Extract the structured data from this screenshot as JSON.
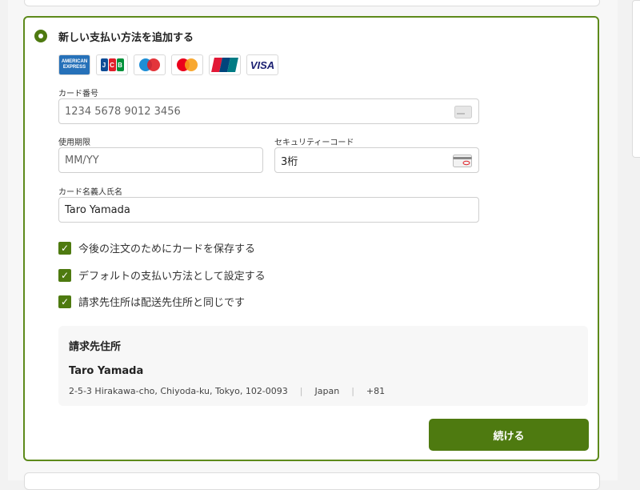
{
  "payment": {
    "title": "新しい支払い方法を追加する",
    "brands": [
      {
        "name": "American Express",
        "text_line1": "AMERICAN",
        "text_line2": "EXPRESS",
        "color": "#2671b9"
      },
      {
        "name": "JCB",
        "letters": [
          "J",
          "C",
          "B"
        ],
        "colors": [
          "#0e4c96",
          "#e11e2a",
          "#00913a"
        ]
      },
      {
        "name": "Maestro",
        "colors": [
          "#1d8ed6",
          "#e01f26"
        ]
      },
      {
        "name": "Mastercard",
        "colors": [
          "#eb001b",
          "#f79e1b"
        ]
      },
      {
        "name": "UnionPay",
        "colors": [
          "#e21836",
          "#00447c",
          "#007b84"
        ]
      },
      {
        "name": "Visa",
        "text": "VISA",
        "color": "#1a1f71"
      }
    ],
    "card_number": {
      "label": "カード番号",
      "placeholder": "1234 5678 9012 3456",
      "icon": "card-icon"
    },
    "expiry": {
      "label": "使用期限",
      "placeholder": "MM/YY"
    },
    "security_code": {
      "label": "セキュリティーコード",
      "placeholder": "3桁",
      "icon": "cvv-card-icon"
    },
    "cardholder": {
      "label": "カード名義人氏名",
      "value": "Taro Yamada"
    },
    "checkboxes": [
      {
        "label": "今後の注文のためにカードを保存する",
        "checked": true
      },
      {
        "label": "デフォルトの支払い方法として設定する",
        "checked": true
      },
      {
        "label": "請求先住所は配送先住所と同じです",
        "checked": true
      }
    ],
    "billing": {
      "title": "請求先住所",
      "name": "Taro Yamada",
      "address": "2-5-3 Hirakawa-cho, Chiyoda-ku, Tokyo, 102-0093",
      "country": "Japan",
      "phone": "+81"
    },
    "continue_label": "続ける",
    "accent_color": "#4e7a10"
  }
}
